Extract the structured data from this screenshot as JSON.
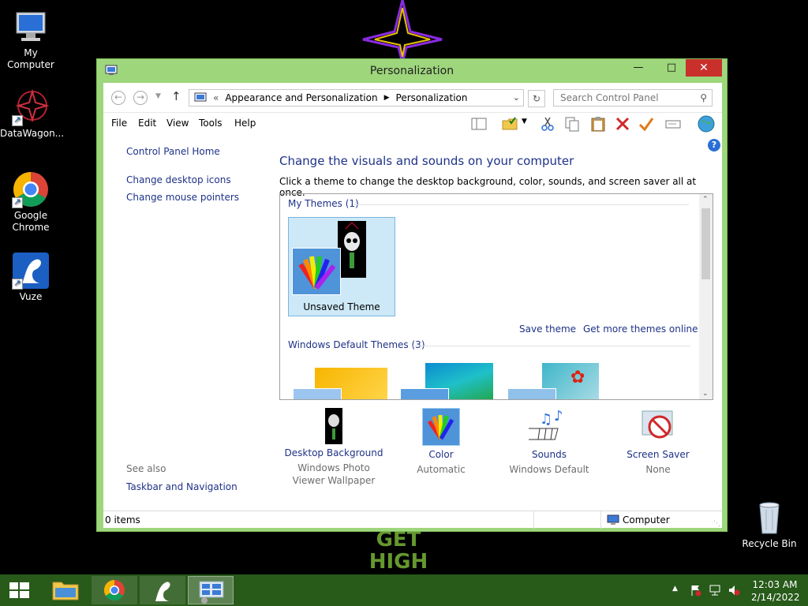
{
  "desktop": {
    "icons": [
      {
        "label": "My Computer"
      },
      {
        "label": "DataWagon..."
      },
      {
        "label": "Google Chrome"
      },
      {
        "label": "Vuze"
      },
      {
        "label": "Recycle Bin"
      }
    ],
    "wallpaper_words": "GET HIGH"
  },
  "window": {
    "title": "Personalization",
    "address": {
      "overflow": "«",
      "crumbs": [
        "Appearance and Personalization",
        "Personalization"
      ]
    },
    "search_placeholder": "Search Control Panel",
    "menu": [
      "File",
      "Edit",
      "View",
      "Tools",
      "Help"
    ],
    "sidebar": {
      "home": "Control Panel Home",
      "links": [
        "Change desktop icons",
        "Change mouse pointers"
      ],
      "see_also_title": "See also",
      "see_also": [
        "Taskbar and Navigation"
      ]
    },
    "main": {
      "heading": "Change the visuals and sounds on your computer",
      "description": "Click a theme to change the desktop background, color, sounds, and screen saver all at once.",
      "my_themes_title": "My Themes (1)",
      "unsaved_theme": "Unsaved Theme",
      "save_theme": "Save theme",
      "get_more": "Get more themes online",
      "default_themes_title": "Windows Default Themes (3)"
    },
    "bottom": [
      {
        "label": "Desktop Background",
        "sub": "Windows Photo Viewer Wallpaper"
      },
      {
        "label": "Color",
        "sub": "Automatic"
      },
      {
        "label": "Sounds",
        "sub": "Windows Default"
      },
      {
        "label": "Screen Saver",
        "sub": "None"
      }
    ],
    "status": {
      "items": "0 items",
      "location": "Computer"
    }
  },
  "taskbar": {
    "time": "12:03 AM",
    "date": "2/14/2022",
    "color": "#285a1a"
  },
  "colors": {
    "window_frame": "#9ed67c",
    "link": "#1e3287",
    "close": "#c9302c"
  }
}
